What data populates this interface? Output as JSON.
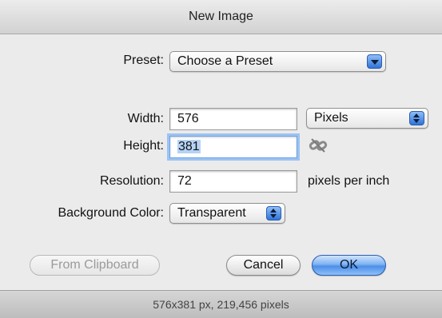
{
  "window": {
    "title": "New Image"
  },
  "preset": {
    "label": "Preset:",
    "value": "Choose a Preset"
  },
  "width": {
    "label": "Width:",
    "value": "576",
    "unit": "Pixels"
  },
  "height": {
    "label": "Height:",
    "value": "381"
  },
  "resolution": {
    "label": "Resolution:",
    "value": "72",
    "unit": "pixels per inch"
  },
  "background": {
    "label": "Background Color:",
    "value": "Transparent"
  },
  "buttons": {
    "from_clipboard": "From Clipboard",
    "cancel": "Cancel",
    "ok": "OK"
  },
  "status": {
    "text": "576x381 px, 219,456 pixels"
  },
  "icons": {
    "constrain": "chain-link-icon"
  },
  "colors": {
    "accent": "#4b8fe8",
    "focus_ring": "#9cc3f3"
  }
}
